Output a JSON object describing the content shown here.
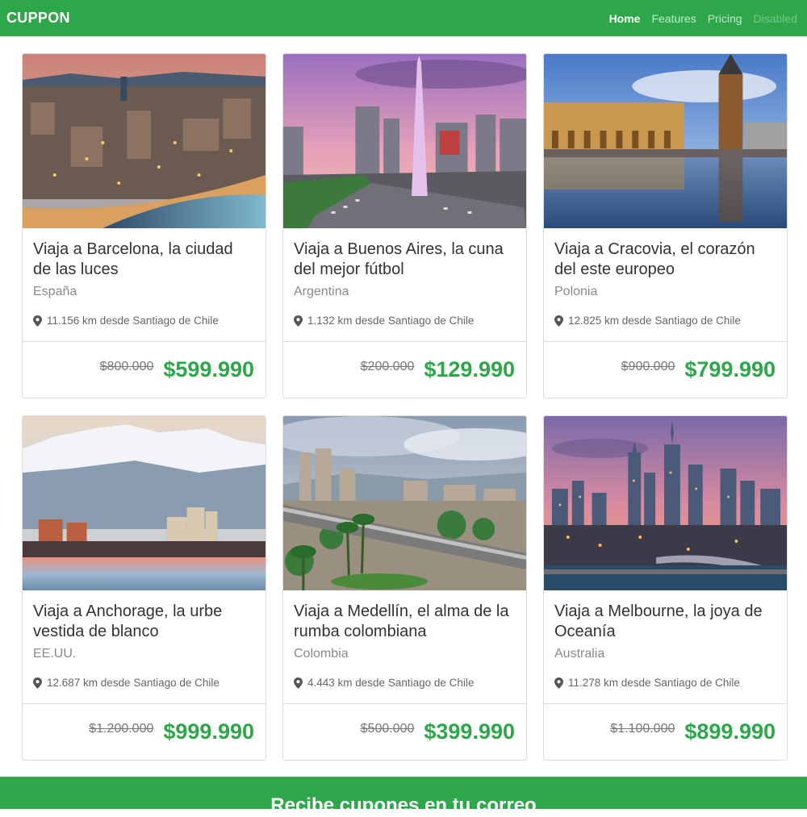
{
  "navbar": {
    "brand": "CUPPON",
    "links": [
      {
        "label": "Home",
        "state": "active"
      },
      {
        "label": "Features",
        "state": "normal"
      },
      {
        "label": "Pricing",
        "state": "normal"
      },
      {
        "label": "Disabled",
        "state": "disabled"
      }
    ]
  },
  "colors": {
    "accent": "#2ea64a",
    "muted_text": "#8a8a8a",
    "border": "#dcdcdc"
  },
  "cards": [
    {
      "title": "Viaja a Barcelona, la ciudad de las luces",
      "country": "España",
      "distance": "11.156 km desde Santiago de Chile",
      "old_price": "$800.000",
      "new_price": "$599.990",
      "image": "barcelona-photo",
      "icon": "map-pin-icon"
    },
    {
      "title": "Viaja a Buenos Aires, la cuna del mejor fútbol",
      "country": "Argentina",
      "distance": "1.132 km desde Santiago de Chile",
      "old_price": "$200.000",
      "new_price": "$129.990",
      "image": "buenos-aires-photo",
      "icon": "map-pin-icon"
    },
    {
      "title": "Viaja a Cracovia, el corazón del este europeo",
      "country": "Polonia",
      "distance": "12.825 km desde Santiago de Chile",
      "old_price": "$900.000",
      "new_price": "$799.990",
      "image": "cracovia-photo",
      "icon": "map-pin-icon"
    },
    {
      "title": "Viaja a Anchorage, la urbe vestida de blanco",
      "country": "EE.UU.",
      "distance": "12.687 km desde Santiago de Chile",
      "old_price": "$1.200.000",
      "new_price": "$999.990",
      "image": "anchorage-photo",
      "icon": "map-pin-icon"
    },
    {
      "title": "Viaja a Medellín, el alma de la rumba colombiana",
      "country": "Colombia",
      "distance": "4.443 km desde Santiago de Chile",
      "old_price": "$500.000",
      "new_price": "$399.990",
      "image": "medellin-photo",
      "icon": "map-pin-icon"
    },
    {
      "title": "Viaja a Melbourne, la joya de Oceanía",
      "country": "Australia",
      "distance": "11.278 km desde Santiago de Chile",
      "old_price": "$1.100.000",
      "new_price": "$899.990",
      "image": "melbourne-photo",
      "icon": "map-pin-icon"
    }
  ],
  "banner": {
    "text": "Recibe cupones en tu correo"
  }
}
